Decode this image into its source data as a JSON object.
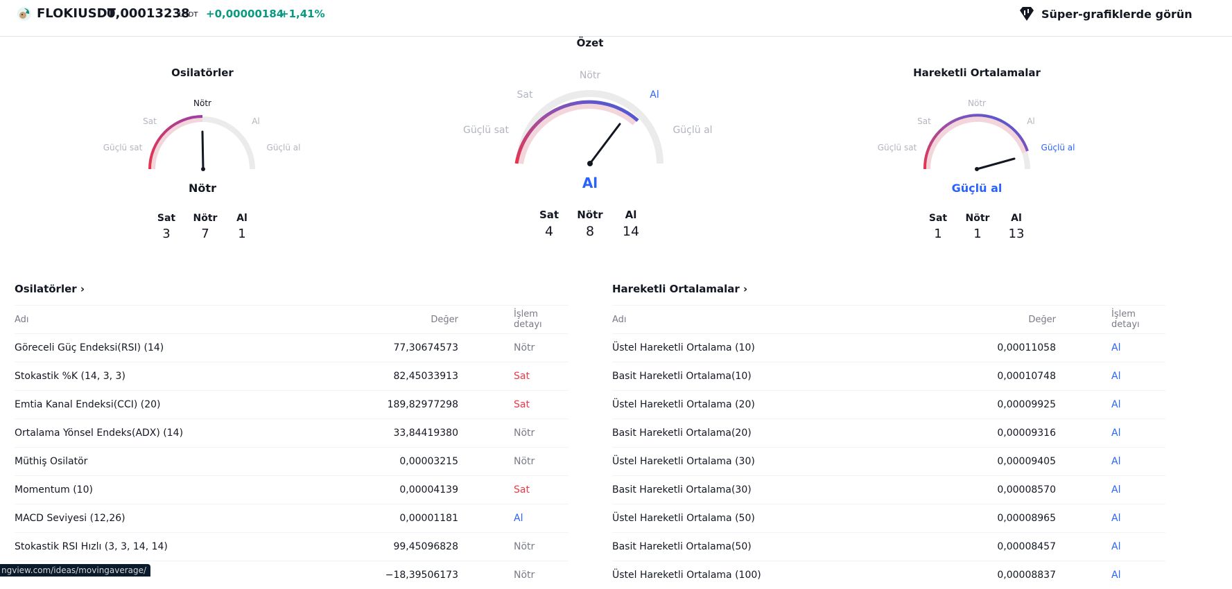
{
  "header": {
    "symbol": "FLOKIUSDT",
    "price": "0,00013238",
    "currency": "USDT",
    "change": "+0,00000184",
    "change_percent": "+1,41%",
    "super_charts": "Süper-grafiklerde görün",
    "change_color": "#089981"
  },
  "gauges": {
    "oscillators": {
      "title": "Osilatörler",
      "labels": {
        "strong_sell": "Güçlü sat",
        "sell": "Sat",
        "neutral": "Nötr",
        "buy": "Al",
        "strong_buy": "Güçlü al"
      },
      "result": "Nötr",
      "counts": [
        {
          "label": "Sat",
          "value": "3"
        },
        {
          "label": "Nötr",
          "value": "7"
        },
        {
          "label": "Al",
          "value": "1"
        }
      ]
    },
    "summary": {
      "title": "Özet",
      "labels": {
        "strong_sell": "Güçlü sat",
        "sell": "Sat",
        "neutral": "Nötr",
        "buy": "Al",
        "strong_buy": "Güçlü al"
      },
      "result": "Al",
      "counts": [
        {
          "label": "Sat",
          "value": "4"
        },
        {
          "label": "Nötr",
          "value": "8"
        },
        {
          "label": "Al",
          "value": "14"
        }
      ]
    },
    "moving_averages": {
      "title": "Hareketli Ortalamalar",
      "labels": {
        "strong_sell": "Güçlü sat",
        "sell": "Sat",
        "neutral": "Nötr",
        "buy": "Al",
        "strong_buy": "Güçlü al"
      },
      "result": "Güçlü al",
      "counts": [
        {
          "label": "Sat",
          "value": "1"
        },
        {
          "label": "Nötr",
          "value": "1"
        },
        {
          "label": "Al",
          "value": "13"
        }
      ]
    }
  },
  "oscillators_table": {
    "title": "Osilatörler",
    "headers": {
      "name": "Adı",
      "value": "Değer",
      "action": "İşlem detayı"
    },
    "rows": [
      {
        "name": "Göreceli Güç Endeksi(RSI) (14)",
        "value": "77,30674573",
        "action": "Nötr"
      },
      {
        "name": "Stokastik %K (14, 3, 3)",
        "value": "82,45033913",
        "action": "Sat"
      },
      {
        "name": "Emtia Kanal Endeksi(CCI) (20)",
        "value": "189,82977298",
        "action": "Sat"
      },
      {
        "name": "Ortalama Yönsel Endeks(ADX) (14)",
        "value": "33,84419380",
        "action": "Nötr"
      },
      {
        "name": "Müthiş Osilatör",
        "value": "0,00003215",
        "action": "Nötr"
      },
      {
        "name": "Momentum (10)",
        "value": "0,00004139",
        "action": "Sat"
      },
      {
        "name": "MACD Seviyesi (12,26)",
        "value": "0,00001181",
        "action": "Al"
      },
      {
        "name": "Stokastik RSI Hızlı (3, 3, 14, 14)",
        "value": "99,45096828",
        "action": "Nötr"
      },
      {
        "name": "",
        "value": "−18,39506173",
        "action": "Nötr"
      }
    ]
  },
  "ma_table": {
    "title": "Hareketli Ortalamalar",
    "headers": {
      "name": "Adı",
      "value": "Değer",
      "action": "İşlem detayı"
    },
    "rows": [
      {
        "name": "Üstel Hareketli Ortalama (10)",
        "value": "0,00011058",
        "action": "Al"
      },
      {
        "name": "Basit Hareketli Ortalama(10)",
        "value": "0,00010748",
        "action": "Al"
      },
      {
        "name": "Üstel Hareketli Ortalama (20)",
        "value": "0,00009925",
        "action": "Al"
      },
      {
        "name": "Basit Hareketli Ortalama(20)",
        "value": "0,00009316",
        "action": "Al"
      },
      {
        "name": "Üstel Hareketli Ortalama (30)",
        "value": "0,00009405",
        "action": "Al"
      },
      {
        "name": "Basit Hareketli Ortalama(30)",
        "value": "0,00008570",
        "action": "Al"
      },
      {
        "name": "Üstel Hareketli Ortalama (50)",
        "value": "0,00008965",
        "action": "Al"
      },
      {
        "name": "Basit Hareketli Ortalama(50)",
        "value": "0,00008457",
        "action": "Al"
      },
      {
        "name": "Üstel Hareketli Ortalama (100)",
        "value": "0,00008837",
        "action": "Al"
      }
    ]
  },
  "status_bar": "ngview.com/ideas/movingaverage/",
  "colors": {
    "sell": "#f23645",
    "buy": "#2962ff",
    "neutral": "#787b86"
  }
}
